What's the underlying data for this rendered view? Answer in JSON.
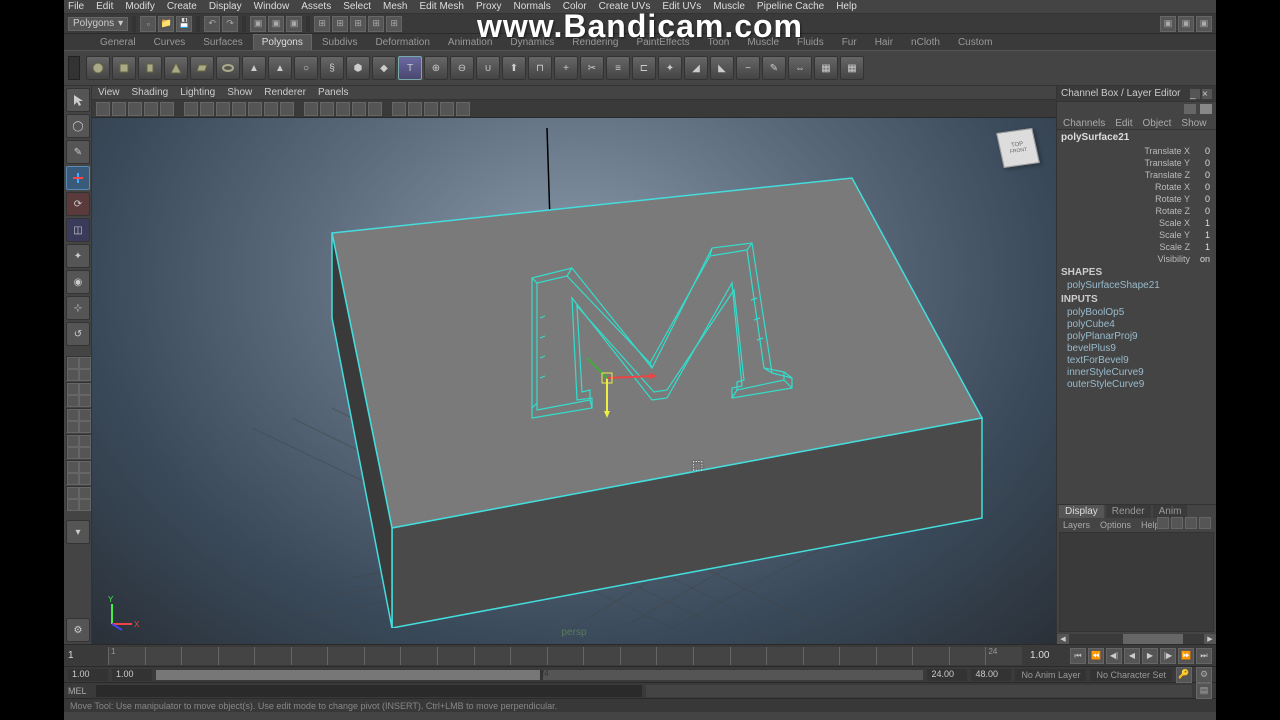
{
  "watermark": "www.Bandicam.com",
  "menubar": [
    "File",
    "Edit",
    "Modify",
    "Create",
    "Display",
    "Window",
    "Assets",
    "Select",
    "Mesh",
    "Edit Mesh",
    "Proxy",
    "Normals",
    "Color",
    "Create UVs",
    "Edit UVs",
    "Muscle",
    "Pipeline Cache",
    "Help"
  ],
  "module_dropdown": "Polygons",
  "module_tabs": [
    "General",
    "Curves",
    "Surfaces",
    "Polygons",
    "Subdivs",
    "Deformation",
    "Animation",
    "Dynamics",
    "Rendering",
    "PaintEffects",
    "Toon",
    "Muscle",
    "Fluids",
    "Fur",
    "Hair",
    "nCloth",
    "Custom"
  ],
  "module_active": "Polygons",
  "panel_menu": [
    "View",
    "Shading",
    "Lighting",
    "Show",
    "Renderer",
    "Panels"
  ],
  "viewcube": {
    "top": "TOP",
    "front": "FRONT"
  },
  "channelbox": {
    "title": "Channel Box / Layer Editor",
    "tabs": [
      "Channels",
      "Edit",
      "Object",
      "Show"
    ],
    "object": "polySurface21",
    "attrs": [
      {
        "lbl": "Translate X",
        "val": "0"
      },
      {
        "lbl": "Translate Y",
        "val": "0"
      },
      {
        "lbl": "Translate Z",
        "val": "0"
      },
      {
        "lbl": "Rotate X",
        "val": "0"
      },
      {
        "lbl": "Rotate Y",
        "val": "0"
      },
      {
        "lbl": "Rotate Z",
        "val": "0"
      },
      {
        "lbl": "Scale X",
        "val": "1"
      },
      {
        "lbl": "Scale Y",
        "val": "1"
      },
      {
        "lbl": "Scale Z",
        "val": "1"
      },
      {
        "lbl": "Visibility",
        "val": "on"
      }
    ],
    "shapes_title": "SHAPES",
    "shape_name": "polySurfaceShape21",
    "inputs_title": "INPUTS",
    "inputs": [
      "polyBoolOp5",
      "polyCube4",
      "polyPlanarProj9",
      "bevelPlus9",
      "textForBevel9",
      "innerStyleCurve9",
      "outerStyleCurve9"
    ]
  },
  "layer_tabs": [
    "Display",
    "Render",
    "Anim"
  ],
  "layer_active": "Display",
  "layer_menu": [
    "Layers",
    "Options",
    "Help"
  ],
  "timeline": {
    "start_field": "1",
    "end_field": "1.00",
    "ticks": [
      1,
      40,
      80,
      120,
      160,
      200,
      240,
      280,
      320,
      360,
      400,
      438,
      477,
      516,
      555,
      594,
      633,
      672,
      711,
      750,
      789,
      828,
      867,
      906,
      945,
      984
    ],
    "labels": [
      "1",
      "",
      "",
      "",
      "",
      "",
      "",
      "",
      "",
      "",
      "",
      "",
      "",
      "",
      "",
      "",
      "",
      "",
      "",
      "",
      "",
      "",
      "",
      "",
      "",
      "24"
    ]
  },
  "range": {
    "f1": "1.00",
    "f2": "1.00",
    "mid": "24",
    "f3": "24.00",
    "f4": "48.00",
    "animlayer": "No Anim Layer",
    "charset": "No Character Set"
  },
  "cmd": {
    "lang": "MEL"
  },
  "helpline": "Move Tool: Use manipulator to move object(s). Use edit mode to change pivot (INSERT). Ctrl+LMB to move perpendicular.",
  "playback_icons": [
    "⏮",
    "⏪",
    "◀|",
    "◀",
    "▶",
    "|▶",
    "⏩",
    "⏭"
  ]
}
